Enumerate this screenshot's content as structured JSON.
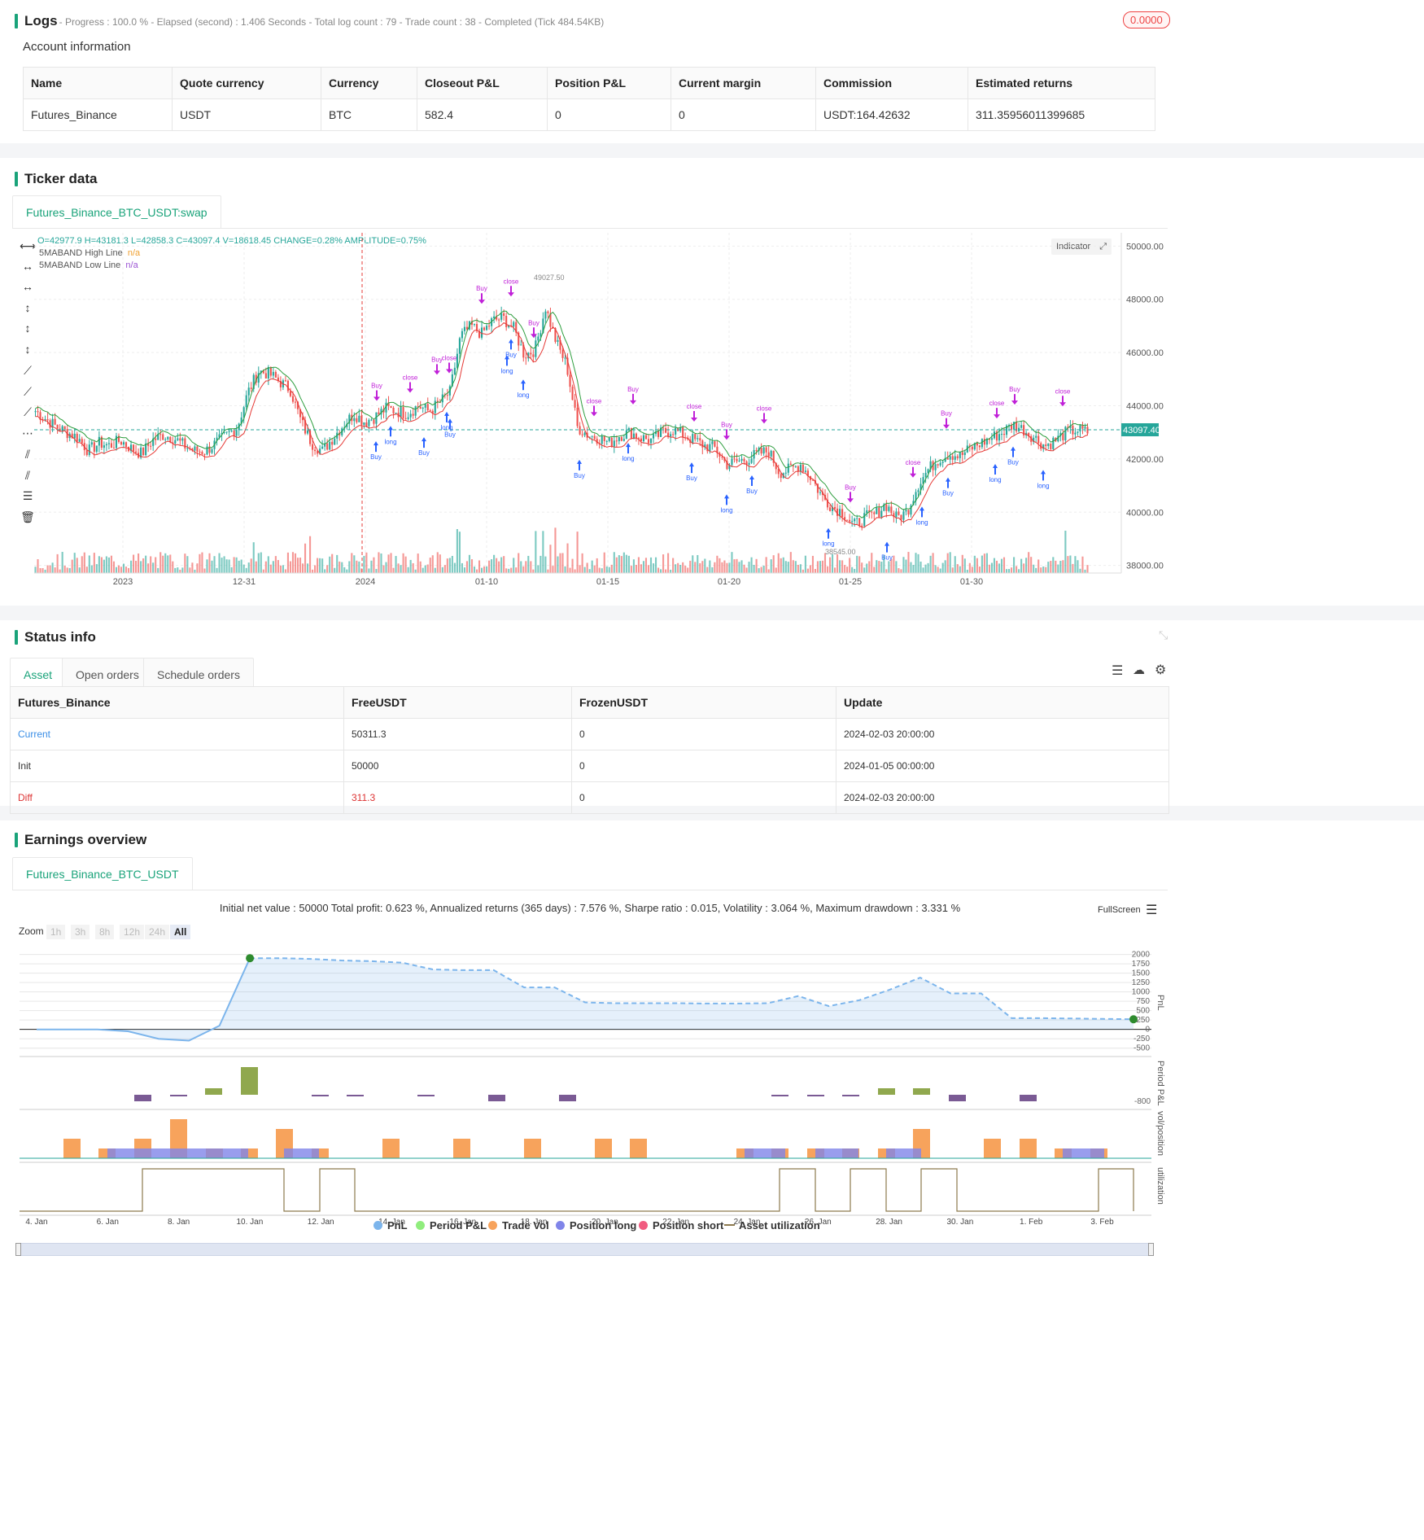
{
  "logs": {
    "title": "Logs",
    "subtitle": "- Progress : 100.0 % - Elapsed (second) : 1.406 Seconds - Total log count : 79 - Trade count : 38 - Completed (Tick 484.54KB)",
    "badge": "0.0000"
  },
  "account": {
    "title": "Account information",
    "headers": [
      "Name",
      "Quote currency",
      "Currency",
      "Closeout P&L",
      "Position P&L",
      "Current margin",
      "Commission",
      "Estimated returns"
    ],
    "row": [
      "Futures_Binance",
      "USDT",
      "BTC",
      "582.4",
      "0",
      "0",
      "USDT:164.42632",
      "311.35956011399685"
    ]
  },
  "ticker": {
    "title": "Ticker data",
    "tab": "Futures_Binance_BTC_USDT:swap",
    "ohlc": "O=42977.9 H=43181.3 L=42858.3 C=43097.4 V=18618.45 CHANGE=0.28% AMPLITUDE=0.75%",
    "legend_high": "5MABAND High Line",
    "legend_low": "5MABAND Low Line",
    "na": "n/a",
    "indicator_btn": "Indicator",
    "current_price": "43097.40",
    "max_label": "49027.50",
    "min_label": "38545.00",
    "colors": {
      "up": "#26a69a",
      "down": "#ef5350",
      "high_line": "#2e9e3e",
      "low_line": "#e53935",
      "accent": "#1aa37a"
    }
  },
  "chart_data": [
    {
      "type": "candlestick",
      "title": "",
      "y_ticks": [
        "50000.00",
        "48000.00",
        "46000.00",
        "44000.00",
        "42000.00",
        "40000.00",
        "38000.00"
      ],
      "x_ticks": [
        "2023",
        "12-31",
        "2024",
        "01-10",
        "01-15",
        "01-20",
        "01-25",
        "01-30"
      ],
      "ylim": [
        37500,
        50500
      ],
      "close_path": [
        43800,
        43500,
        43200,
        43000,
        42800,
        42300,
        42600,
        42500,
        42700,
        42400,
        42200,
        42700,
        42900,
        42800,
        42500,
        42300,
        42300,
        42600,
        42900,
        43200,
        44500,
        45300,
        45200,
        44900,
        44600,
        43400,
        42600,
        42300,
        42800,
        43300,
        43700,
        43400,
        43600,
        43900,
        43800,
        43700,
        44000,
        43800,
        44100,
        44500,
        46600,
        47000,
        46700,
        47200,
        47300,
        46900,
        45900,
        46100,
        47700,
        46400,
        45500,
        43200,
        42900,
        42800,
        42600,
        42900,
        43000,
        42800,
        42700,
        43000,
        43100,
        42900,
        42700,
        42500,
        42400,
        41800,
        41900,
        42000,
        42200,
        42300,
        41500,
        41600,
        41800,
        41300,
        40600,
        40200,
        40000,
        39500,
        39800,
        39900,
        40300,
        39800,
        40000,
        41000,
        41600,
        42000,
        42200,
        42100,
        42400,
        42600,
        42800,
        43000,
        43300,
        43100,
        42800,
        42500,
        42700,
        43000,
        43100,
        43000
      ],
      "bands": "5MABAND High Line / 5MABAND Low Line"
    },
    {
      "type": "line",
      "title": "Initial net value : 50000 Total profit: 0.623 %, Annualized returns (365 days) : 7.576 %, Sharpe ratio : 0.015, Volatility : 3.064 %, Maximum drawdown : 3.331 %",
      "series": [
        {
          "name": "PnL",
          "values": [
            0,
            0,
            0,
            -50,
            -250,
            -300,
            100,
            1900,
            1900,
            1880,
            1840,
            1820,
            1780,
            1600,
            1580,
            1580,
            1120,
            1120,
            720,
            700,
            700,
            700,
            690,
            690,
            700,
            890,
            620,
            780,
            1060,
            1380,
            960,
            960,
            300,
            300,
            290,
            280,
            270
          ]
        }
      ],
      "y_ticks": [
        "2000",
        "1750",
        "1500",
        "1250",
        "1000",
        "750",
        "500",
        "250",
        "0",
        "-250",
        "-500"
      ],
      "x_ticks": [
        "4. Jan",
        "6. Jan",
        "8. Jan",
        "10. Jan",
        "12. Jan",
        "14. Jan",
        "16. Jan",
        "18. Jan",
        "20. Jan",
        "22. Jan",
        "24. Jan",
        "26. Jan",
        "28. Jan",
        "30. Jan",
        "1. Feb",
        "3. Feb"
      ],
      "ylim": [
        -550,
        2100
      ]
    }
  ],
  "status": {
    "title": "Status info",
    "tabs": [
      "Asset",
      "Open orders",
      "Schedule orders"
    ],
    "headers": [
      "Futures_Binance",
      "FreeUSDT",
      "FrozenUSDT",
      "Update"
    ],
    "rows": [
      [
        "Current",
        "50311.3",
        "0",
        "2024-02-03 20:00:00"
      ],
      [
        "Init",
        "50000",
        "0",
        "2024-01-05 00:00:00"
      ],
      [
        "Diff",
        "311.3",
        "0",
        "2024-02-03 20:00:00"
      ]
    ]
  },
  "earnings": {
    "title": "Earnings overview",
    "tab": "Futures_Binance_BTC_USDT",
    "summary": "Initial net value : 50000 Total profit: 0.623 %, Annualized returns (365 days) : 7.576 %, Sharpe ratio : 0.015, Volatility : 3.064 %, Maximum drawdown : 3.331 %",
    "fullscreen": "FullScreen",
    "zoom_label": "Zoom",
    "zoom_buttons": [
      "1h",
      "3h",
      "8h",
      "12h",
      "24h",
      "All"
    ],
    "axis_pnl": "PnL",
    "axis_period": "Period P&L",
    "axis_vol": "vol/position",
    "axis_util": "utilization",
    "period_min": "-800",
    "legend": [
      "PnL",
      "Period P&L",
      "Trade Vol",
      "Position long",
      "Position short",
      "Asset utilization"
    ],
    "legend_colors": [
      "#7cb5ec",
      "#90ed7d",
      "#f7a35c",
      "#8085e9",
      "#f15c80",
      "#8d7a4e"
    ]
  }
}
